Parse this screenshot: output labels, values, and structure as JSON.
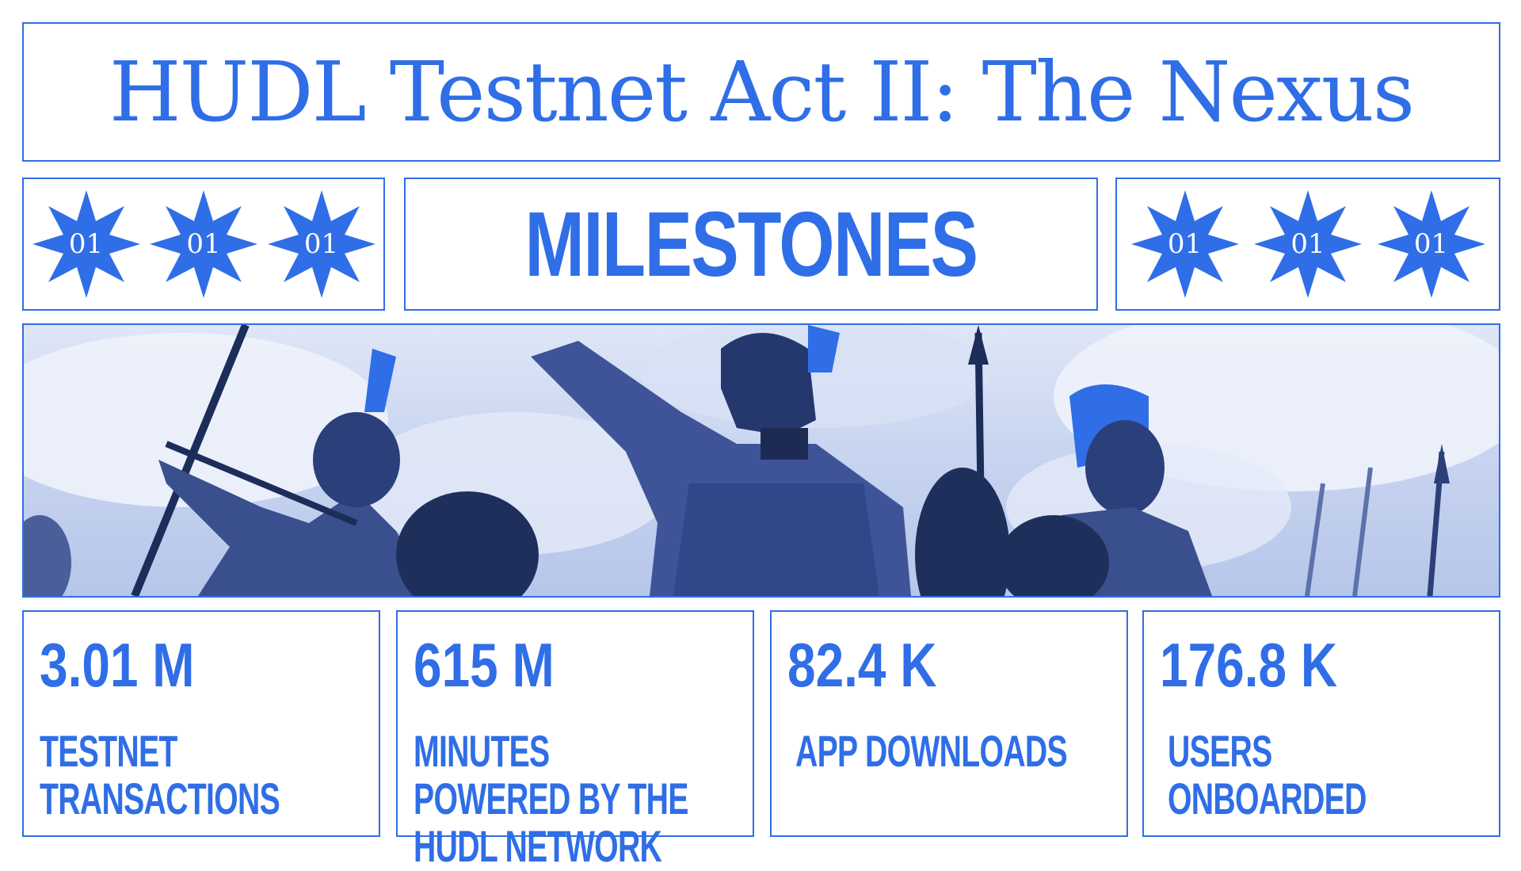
{
  "header": {
    "title": "HUDL Testnet Act II: The Nexus"
  },
  "badges_left": [
    {
      "label": "01"
    },
    {
      "label": "01"
    },
    {
      "label": "01"
    }
  ],
  "section": {
    "title": "MILESTONES"
  },
  "badges_right": [
    {
      "label": "01"
    },
    {
      "label": "01"
    },
    {
      "label": "01"
    }
  ],
  "hero": {
    "icon": "spartan-warriors-illustration"
  },
  "stats": [
    {
      "value": "3.01 M",
      "label": "TESTNET TRANSACTIONS"
    },
    {
      "value": "615 M",
      "label": "MINUTES POWERED BY THE HUDL NETWORK"
    },
    {
      "value": "82.4 K",
      "label": "APP DOWNLOADS"
    },
    {
      "value": "176.8 K",
      "label": "USERS ONBOARDED"
    }
  ],
  "colors": {
    "accent": "#2f6ee6",
    "background": "#ffffff"
  }
}
